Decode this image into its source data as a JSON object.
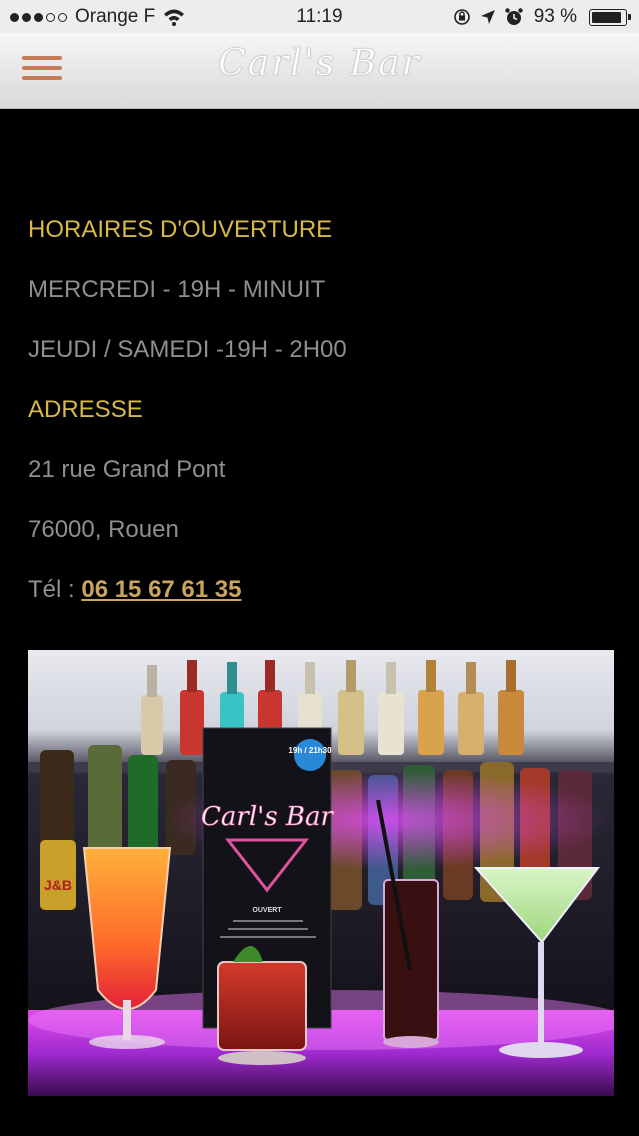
{
  "status_bar": {
    "carrier": "Orange F",
    "time": "11:19",
    "battery_percent": "93 %",
    "battery_level": 0.93
  },
  "header": {
    "logo_text": "Carl's Bar"
  },
  "content": {
    "hours_heading": "HORAIRES D'OUVERTURE",
    "hours_line_1": "MERCREDI - 19H - MINUIT",
    "hours_line_2": "JEUDI / SAMEDI -19H - 2H00",
    "address_heading": "ADRESSE",
    "address_line_1": "21 rue Grand Pont",
    "address_line_2": "76000, Rouen",
    "phone_label": "Tél : ",
    "phone_number": "06 15 67 61 35"
  },
  "photo": {
    "menu_card_title": "Carl's Bar",
    "menu_card_badge": "19h / 21h30",
    "menu_card_subtitle": "OUVERT",
    "bottle_label": "J&B"
  },
  "colors": {
    "heading": "#d9b84a",
    "text": "#8f8f8f",
    "link": "#c9a45c",
    "menu_icon": "#c57d57",
    "background": "#000000"
  }
}
